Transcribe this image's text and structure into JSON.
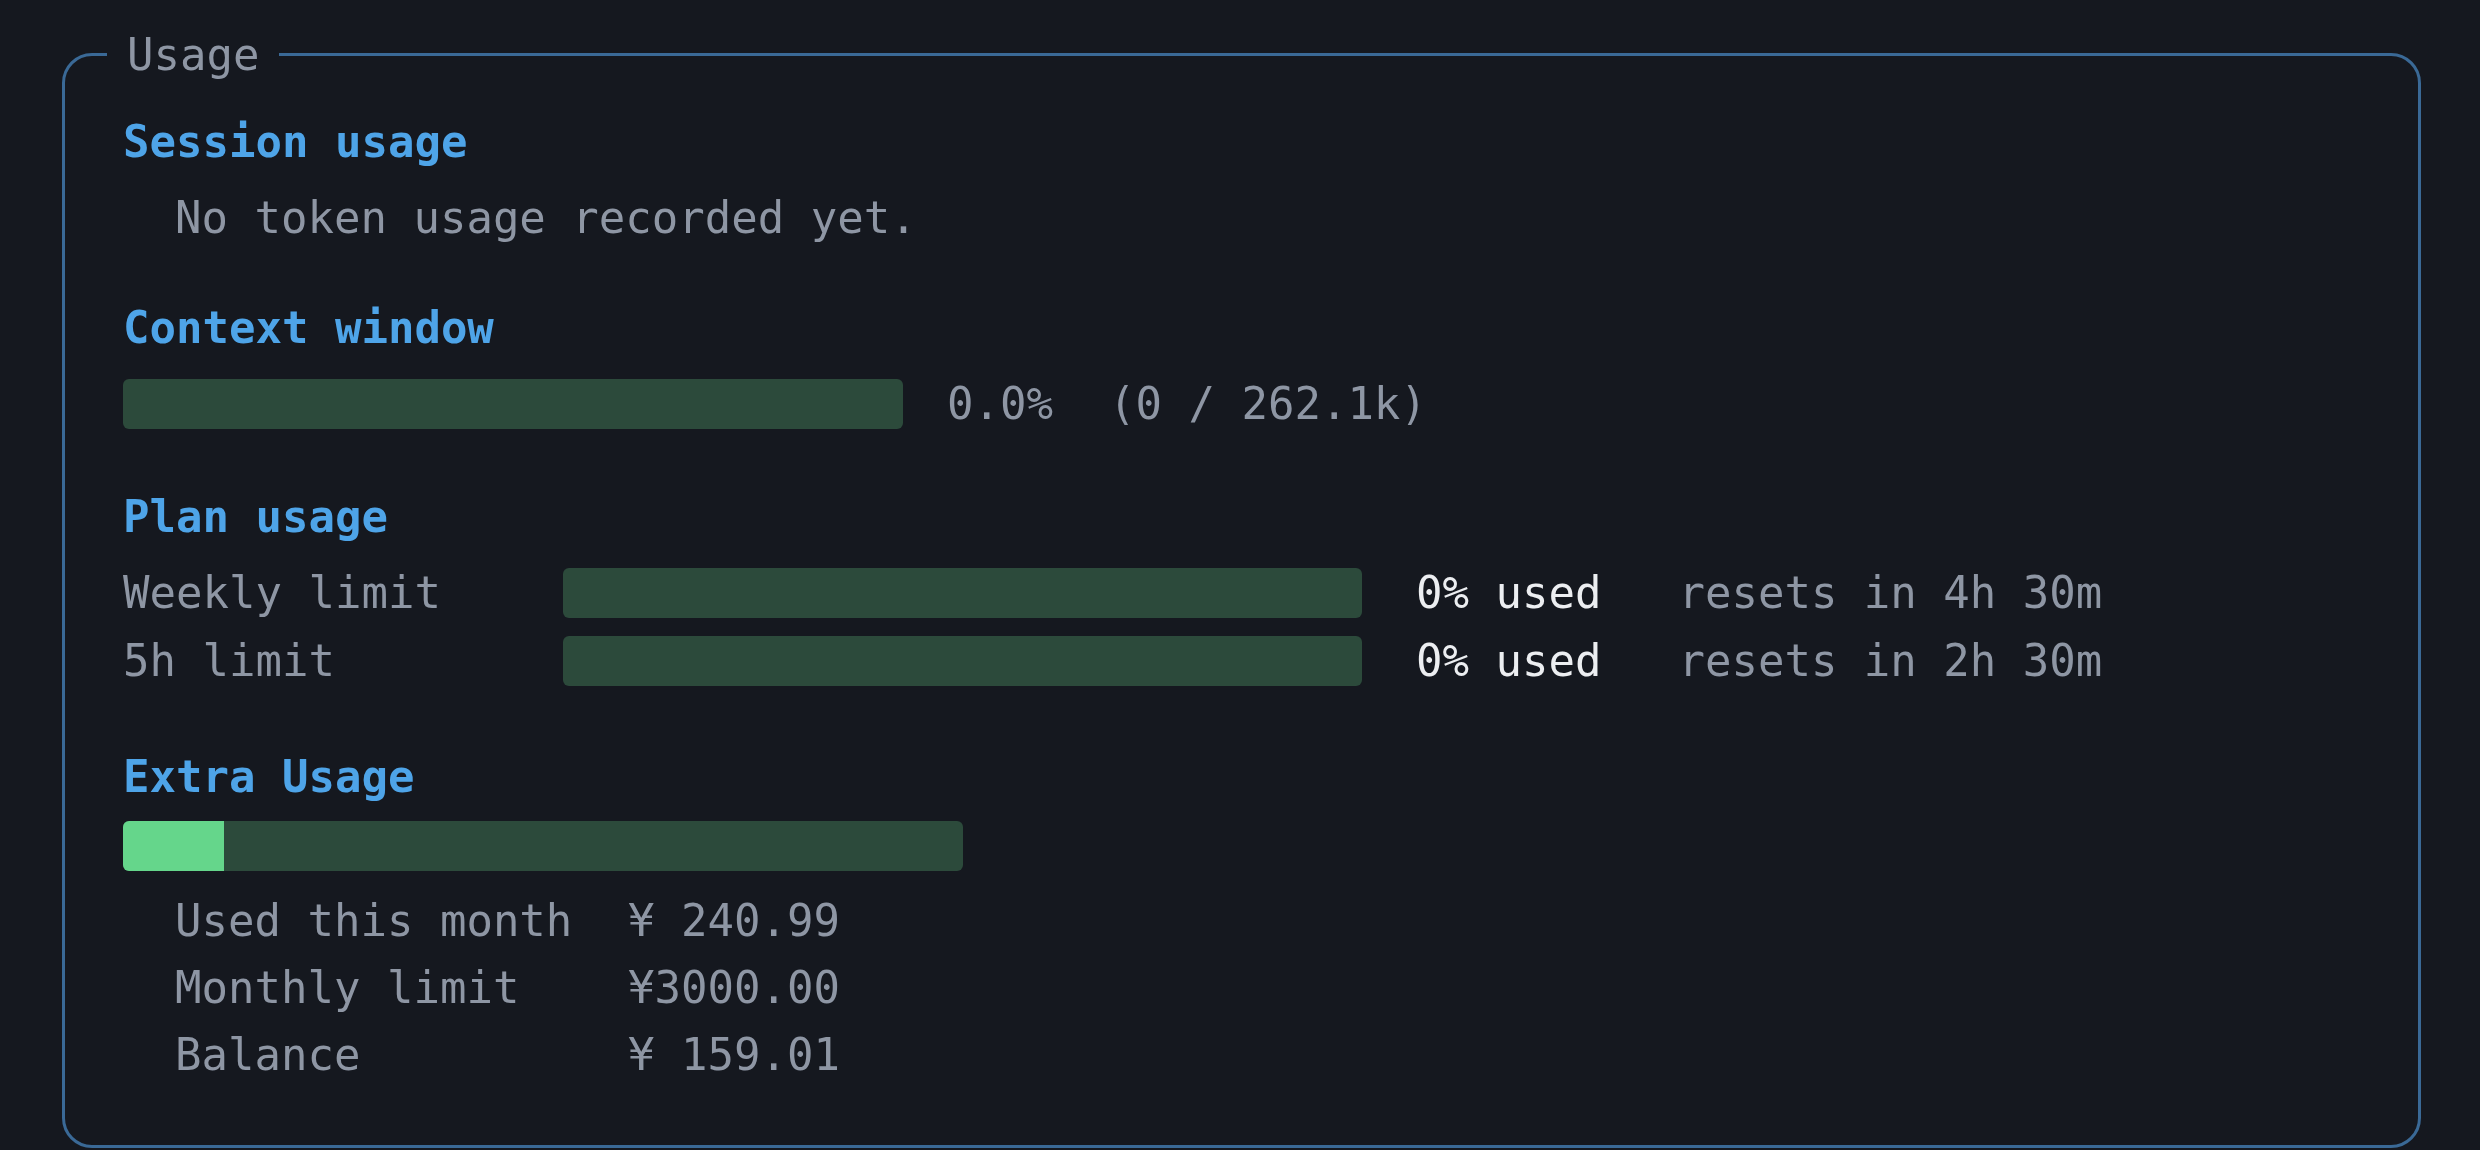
{
  "panel": {
    "title": "Usage"
  },
  "sections": [
    {
      "kind": "message",
      "heading": "Session usage",
      "message": "No token usage recorded yet."
    },
    {
      "kind": "context",
      "heading": "Context window",
      "meter": {
        "level": 0,
        "percent": "0.0%",
        "detail": "(0 / 262.1k)"
      }
    },
    {
      "kind": "limits",
      "heading": "Plan usage",
      "limits": [
        {
          "label": "Weekly limit",
          "level": 0,
          "used": "0% used",
          "resets": "resets in 4h 30m"
        },
        {
          "label": "5h limit",
          "level": 0,
          "used": "0% used",
          "resets": "resets in 2h 30m"
        }
      ]
    },
    {
      "kind": "extra",
      "heading": "Extra Usage",
      "meter": {
        "level": 0.12
      },
      "rows": [
        {
          "label": "Used this month",
          "value": "¥ 240.99"
        },
        {
          "label": "Monthly limit",
          "value": "¥3000.00"
        },
        {
          "label": "Balance",
          "value": "¥ 159.01"
        }
      ]
    }
  ]
}
